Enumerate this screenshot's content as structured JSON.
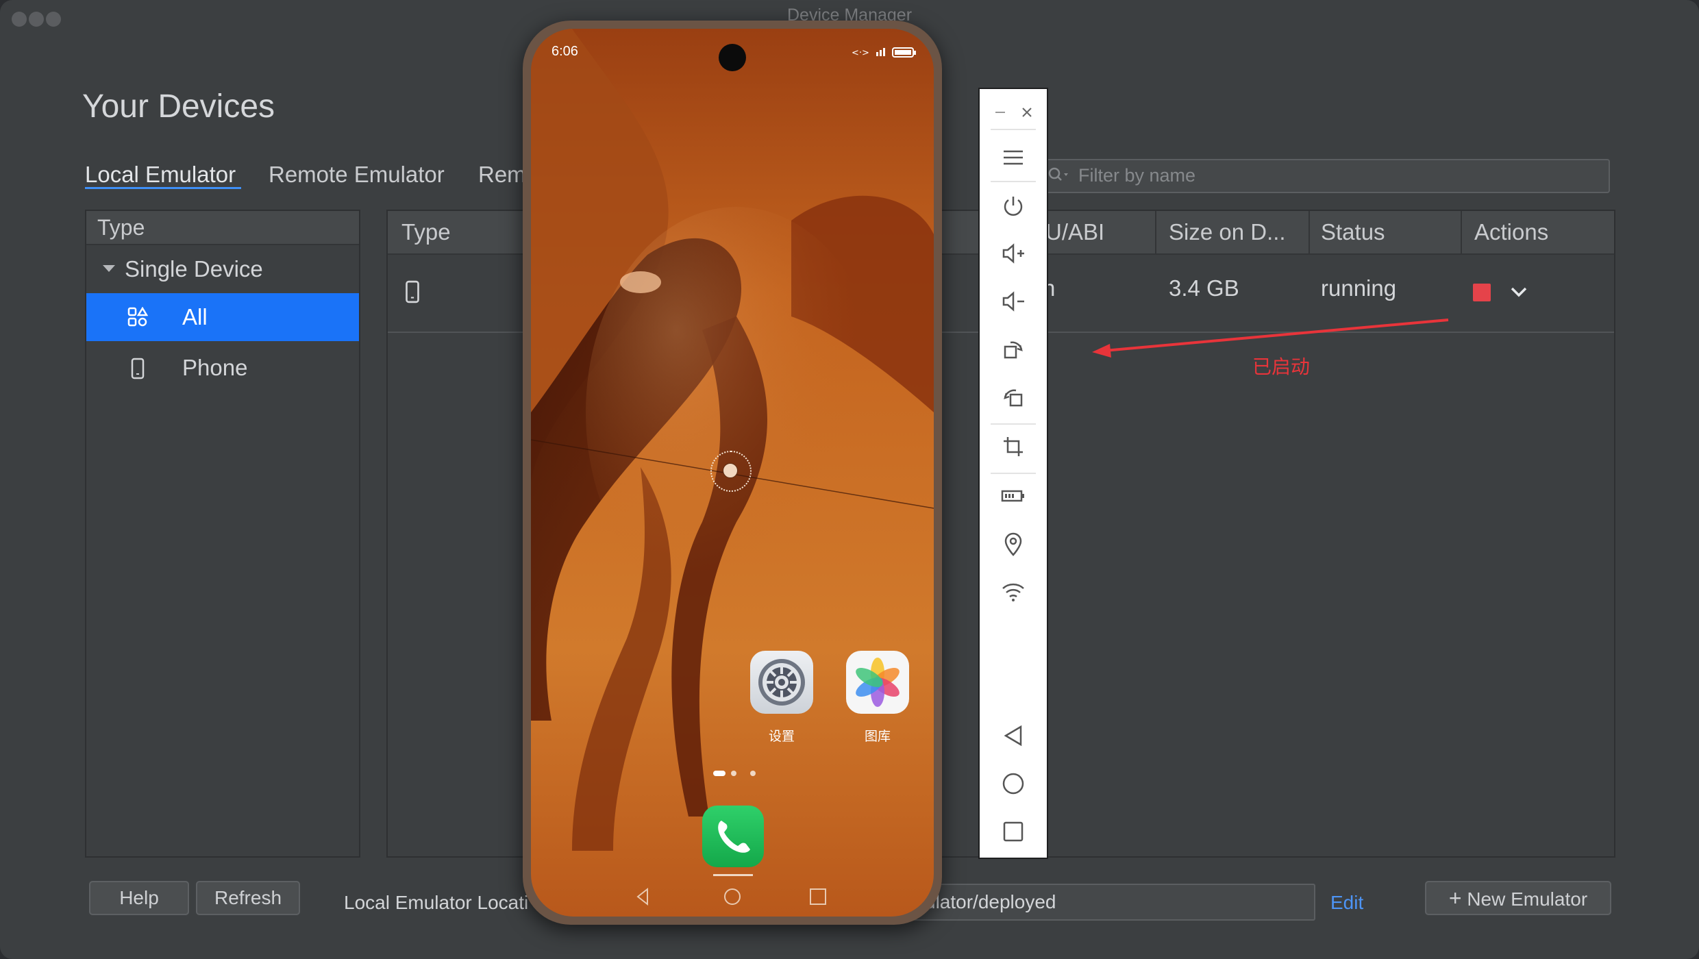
{
  "window": {
    "title": "Device Manager"
  },
  "page": {
    "title": "Your Devices"
  },
  "tabs": [
    {
      "label": "Local Emulator",
      "active": true
    },
    {
      "label": "Remote Emulator",
      "active": false
    },
    {
      "label": "Rem",
      "active": false
    }
  ],
  "filter": {
    "placeholder": "Filter by name"
  },
  "tree": {
    "header": "Type",
    "group": "Single Device",
    "items": [
      {
        "label": "All",
        "selected": true,
        "icon": "all-grid-icon"
      },
      {
        "label": "Phone",
        "selected": false,
        "icon": "phone-icon"
      }
    ]
  },
  "table": {
    "columns": [
      "Type",
      "U/ABI",
      "Size on D...",
      "Status",
      "Actions"
    ],
    "rows": [
      {
        "type_icon": "phone-icon",
        "abi_fragment": "n",
        "size": "3.4 GB",
        "status": "running",
        "stop_color": "#e5434a"
      }
    ]
  },
  "annotation": {
    "text": "已启动",
    "color": "#e8343a"
  },
  "footer": {
    "help": "Help",
    "refresh": "Refresh",
    "location_label": "Local Emulator Locati",
    "location_value": "ulator/deployed",
    "edit": "Edit",
    "new_emulator": "New Emulator"
  },
  "phone": {
    "time": "6:06",
    "apps": [
      {
        "label": "设置",
        "icon": "settings-icon"
      },
      {
        "label": "图库",
        "icon": "gallery-icon"
      }
    ],
    "dock_app": "phone-call-icon",
    "page_count": 3,
    "current_page": 1
  },
  "emulator_toolbar": {
    "icons": [
      "minimize-icon",
      "close-icon",
      "menu-icon",
      "power-icon",
      "volume-up-icon",
      "volume-down-icon",
      "rotate-left-icon",
      "rotate-right-icon",
      "screenshot-crop-icon",
      "battery-icon",
      "location-pin-icon",
      "wifi-icon",
      "back-icon",
      "home-icon",
      "recents-icon"
    ]
  },
  "colors": {
    "accent": "#3f8ff7",
    "selection": "#1a73f8",
    "background": "#3c3f41"
  }
}
